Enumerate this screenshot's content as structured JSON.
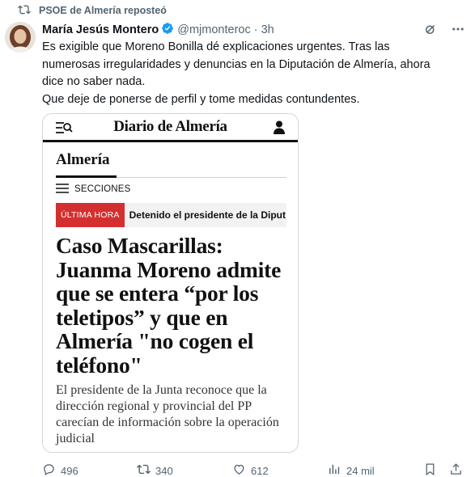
{
  "repost": {
    "text": "PSOE de Almería reposteó"
  },
  "tweet": {
    "author_name": "María Jesús Montero",
    "handle": "@mjmonteroc",
    "separator": "·",
    "time": "3h",
    "text_lines": [
      "Es exigible que Moreno Bonilla dé explicaciones urgentes. Tras las",
      "numerosas irregularidades y denuncias en la Diputación de Almería, ahora",
      "dice no saber nada.",
      "Que deje de ponerse de perfil y tome medidas contundentes."
    ]
  },
  "card": {
    "brand": "Diario de Almería",
    "section": "Almería",
    "menu_label": "SECCIONES",
    "breaking_badge": "ÚLTIMA HORA",
    "breaking_text": "Detenido el presidente de la Diput",
    "headline": "Caso Mascarillas: Juanma Moreno admite que se entera “por los teletipos” y que en Almería \"no cogen el teléfono\"",
    "subhead": "El presidente de la Junta reconoce que la dirección regional y provincial del PP carecían de información sobre la operación judicial"
  },
  "actions": {
    "replies": "496",
    "reposts": "340",
    "likes": "612",
    "views": "24 mil"
  },
  "colors": {
    "muted": "#536471",
    "verified_blue": "#1d9bf0",
    "breaking_red": "#d32f2f"
  },
  "icons": [
    "repost-icon",
    "verified-badge-icon",
    "grok-icon",
    "more-icon",
    "menu-search-icon",
    "user-icon",
    "hamburger-icon",
    "reply-icon",
    "like-icon",
    "views-icon",
    "bookmark-icon",
    "share-icon"
  ]
}
